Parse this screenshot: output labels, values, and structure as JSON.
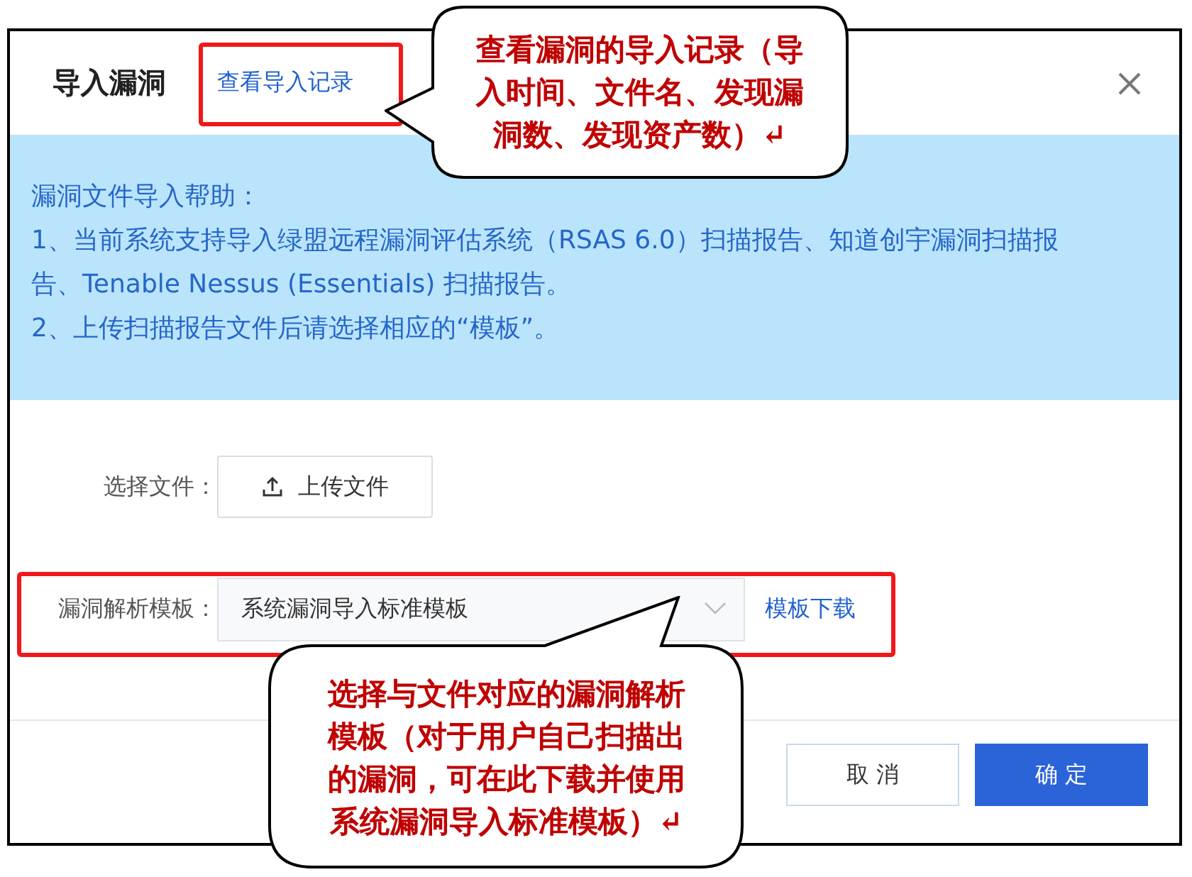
{
  "dialog": {
    "title": "导入漏洞",
    "record_link": "查看导入记录",
    "help": {
      "title": "漏洞文件导入帮助：",
      "lines": [
        "1、当前系统支持导入绿盟远程漏洞评估系统（RSAS 6.0）扫描报告、知道创宇漏洞扫描报告、Tenable Nessus (Essentials) 扫描报告。",
        "2、上传扫描报告文件后请选择相应的“模板”。"
      ]
    },
    "form": {
      "file_label": "选择文件：",
      "upload_button": "上传文件",
      "template_label": "漏洞解析模板：",
      "template_value": "系统漏洞导入标准模板",
      "download_link": "模板下载"
    },
    "buttons": [
      {
        "label": "取 消",
        "kind": "secondary"
      },
      {
        "label": "确 定",
        "kind": "primary"
      }
    ]
  },
  "callouts": [
    {
      "text": "查看漏洞的导入记录（导入时间、文件名、发现漏洞数、发现资产数）↵"
    },
    {
      "text": "选择与文件对应的漏洞解析模板（对于用户自己扫描出的漏洞，可在此下载并使用系统漏洞导入标准模板）↵"
    }
  ]
}
